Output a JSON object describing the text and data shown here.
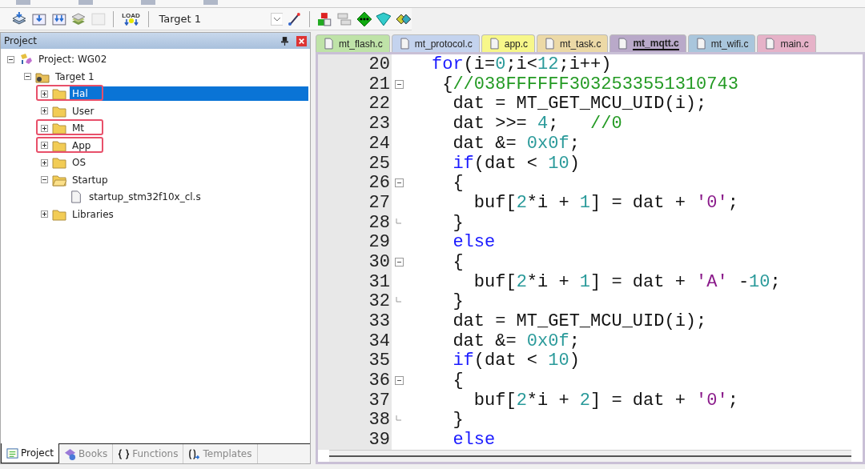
{
  "toolbar": {
    "load_label": "LOAD",
    "target": "Target 1"
  },
  "project_panel": {
    "title": "Project",
    "tree": [
      {
        "label": "Project: WG02",
        "kind": "project",
        "expanded": true,
        "selected": false,
        "annotated": false,
        "children": [
          {
            "label": "Target 1",
            "kind": "target",
            "expanded": true,
            "selected": false,
            "annotated": false,
            "children": [
              {
                "label": "Hal",
                "kind": "folder",
                "expanded": false,
                "selected": true,
                "annotated": true
              },
              {
                "label": "User",
                "kind": "folder",
                "expanded": false,
                "selected": false,
                "annotated": false
              },
              {
                "label": "Mt",
                "kind": "folder",
                "expanded": false,
                "selected": false,
                "annotated": true
              },
              {
                "label": "App",
                "kind": "folder",
                "expanded": false,
                "selected": false,
                "annotated": true
              },
              {
                "label": "OS",
                "kind": "folder",
                "expanded": false,
                "selected": false,
                "annotated": false
              },
              {
                "label": "Startup",
                "kind": "folder",
                "expanded": true,
                "selected": false,
                "annotated": false,
                "children": [
                  {
                    "label": "startup_stm32f10x_cl.s",
                    "kind": "file",
                    "selected": false,
                    "annotated": false
                  }
                ]
              },
              {
                "label": "Libraries",
                "kind": "folder",
                "expanded": false,
                "selected": false,
                "annotated": false
              }
            ]
          }
        ]
      }
    ],
    "bottom_tabs": [
      {
        "label": "Project",
        "kind": "project",
        "selected": true
      },
      {
        "label": "Books",
        "kind": "books",
        "selected": false
      },
      {
        "label": "Functions",
        "kind": "functions",
        "selected": false
      },
      {
        "label": "Templates",
        "kind": "templates",
        "selected": false
      }
    ]
  },
  "editor_tabs": [
    {
      "label": "mt_flash.c",
      "color": "#bfe3a8",
      "selected": false
    },
    {
      "label": "mt_protocol.c",
      "color": "#c4d3ee",
      "selected": false
    },
    {
      "label": "app.c",
      "color": "#f7f78a",
      "selected": false
    },
    {
      "label": "mt_task.c",
      "color": "#ecd9a6",
      "selected": false
    },
    {
      "label": "mt_mqtt.c",
      "color": "#b9a9c9",
      "selected": true
    },
    {
      "label": "mt_wifi.c",
      "color": "#a9c6dc",
      "selected": false
    },
    {
      "label": "main.c",
      "color": "#e6b2c8",
      "selected": false
    }
  ],
  "code": [
    {
      "number": "20",
      "fold_start": false,
      "fold_end": false,
      "tokens": [
        {
          "kind": "kw",
          "text": "for"
        },
        {
          "kind": "plain",
          "text": "(i="
        },
        {
          "kind": "num",
          "text": "0"
        },
        {
          "kind": "plain",
          "text": ";i<"
        },
        {
          "kind": "num",
          "text": "12"
        },
        {
          "kind": "plain",
          "text": ";i++)"
        }
      ]
    },
    {
      "number": "21",
      "fold_start": true,
      "fold_end": false,
      "tokens": [
        {
          "kind": "plain",
          "text": " {"
        },
        {
          "kind": "com",
          "text": "//038FFFFFF3032533551310743"
        }
      ]
    },
    {
      "number": "22",
      "fold_start": false,
      "fold_end": false,
      "tokens": [
        {
          "kind": "plain",
          "text": "  dat = MT_GET_MCU_UID(i);"
        }
      ]
    },
    {
      "number": "23",
      "fold_start": false,
      "fold_end": false,
      "tokens": [
        {
          "kind": "plain",
          "text": "  dat >>= "
        },
        {
          "kind": "num",
          "text": "4"
        },
        {
          "kind": "plain",
          "text": ";   "
        },
        {
          "kind": "com",
          "text": "//0"
        }
      ]
    },
    {
      "number": "24",
      "fold_start": false,
      "fold_end": false,
      "tokens": [
        {
          "kind": "plain",
          "text": "  dat &= "
        },
        {
          "kind": "num",
          "text": "0x0f"
        },
        {
          "kind": "plain",
          "text": ";"
        }
      ]
    },
    {
      "number": "25",
      "fold_start": false,
      "fold_end": false,
      "tokens": [
        {
          "kind": "kw",
          "text": "  if"
        },
        {
          "kind": "plain",
          "text": "(dat < "
        },
        {
          "kind": "num",
          "text": "10"
        },
        {
          "kind": "plain",
          "text": ")"
        }
      ]
    },
    {
      "number": "26",
      "fold_start": true,
      "fold_end": false,
      "tokens": [
        {
          "kind": "plain",
          "text": "  {"
        }
      ]
    },
    {
      "number": "27",
      "fold_start": false,
      "fold_end": false,
      "tokens": [
        {
          "kind": "plain",
          "text": "    buf["
        },
        {
          "kind": "num",
          "text": "2"
        },
        {
          "kind": "plain",
          "text": "*i + "
        },
        {
          "kind": "num",
          "text": "1"
        },
        {
          "kind": "plain",
          "text": "] = dat + "
        },
        {
          "kind": "str",
          "text": "'0'"
        },
        {
          "kind": "plain",
          "text": ";"
        }
      ]
    },
    {
      "number": "28",
      "fold_start": false,
      "fold_end": true,
      "tokens": [
        {
          "kind": "plain",
          "text": "  }"
        }
      ]
    },
    {
      "number": "29",
      "fold_start": false,
      "fold_end": false,
      "tokens": [
        {
          "kind": "kw",
          "text": "  else"
        }
      ]
    },
    {
      "number": "30",
      "fold_start": true,
      "fold_end": false,
      "tokens": [
        {
          "kind": "plain",
          "text": "  {"
        }
      ]
    },
    {
      "number": "31",
      "fold_start": false,
      "fold_end": false,
      "tokens": [
        {
          "kind": "plain",
          "text": "    buf["
        },
        {
          "kind": "num",
          "text": "2"
        },
        {
          "kind": "plain",
          "text": "*i + "
        },
        {
          "kind": "num",
          "text": "1"
        },
        {
          "kind": "plain",
          "text": "] = dat + "
        },
        {
          "kind": "str",
          "text": "'A'"
        },
        {
          "kind": "plain",
          "text": " -"
        },
        {
          "kind": "num",
          "text": "10"
        },
        {
          "kind": "plain",
          "text": ";"
        }
      ]
    },
    {
      "number": "32",
      "fold_start": false,
      "fold_end": true,
      "tokens": [
        {
          "kind": "plain",
          "text": "  }"
        }
      ]
    },
    {
      "number": "33",
      "fold_start": false,
      "fold_end": false,
      "tokens": [
        {
          "kind": "plain",
          "text": "  dat = MT_GET_MCU_UID(i);"
        }
      ]
    },
    {
      "number": "34",
      "fold_start": false,
      "fold_end": false,
      "tokens": [
        {
          "kind": "plain",
          "text": "  dat &= "
        },
        {
          "kind": "num",
          "text": "0x0f"
        },
        {
          "kind": "plain",
          "text": ";"
        }
      ]
    },
    {
      "number": "35",
      "fold_start": false,
      "fold_end": false,
      "tokens": [
        {
          "kind": "kw",
          "text": "  if"
        },
        {
          "kind": "plain",
          "text": "(dat < "
        },
        {
          "kind": "num",
          "text": "10"
        },
        {
          "kind": "plain",
          "text": ")"
        }
      ]
    },
    {
      "number": "36",
      "fold_start": true,
      "fold_end": false,
      "tokens": [
        {
          "kind": "plain",
          "text": "  {"
        }
      ]
    },
    {
      "number": "37",
      "fold_start": false,
      "fold_end": false,
      "tokens": [
        {
          "kind": "plain",
          "text": "    buf["
        },
        {
          "kind": "num",
          "text": "2"
        },
        {
          "kind": "plain",
          "text": "*i + "
        },
        {
          "kind": "num",
          "text": "2"
        },
        {
          "kind": "plain",
          "text": "] = dat + "
        },
        {
          "kind": "str",
          "text": "'0'"
        },
        {
          "kind": "plain",
          "text": ";"
        }
      ]
    },
    {
      "number": "38",
      "fold_start": false,
      "fold_end": true,
      "tokens": [
        {
          "kind": "plain",
          "text": "  }"
        }
      ]
    },
    {
      "number": "39",
      "fold_start": false,
      "fold_end": false,
      "tokens": [
        {
          "kind": "kw",
          "text": "  else"
        }
      ]
    }
  ]
}
